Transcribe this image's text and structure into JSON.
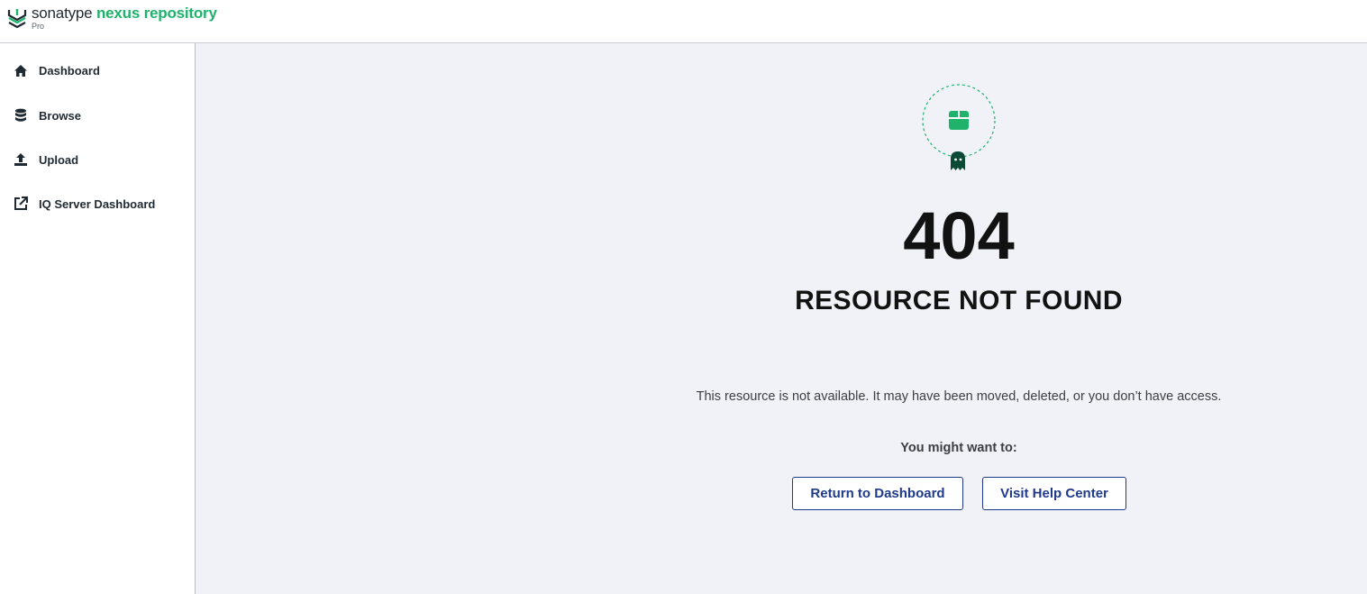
{
  "header": {
    "brand": "sonatype",
    "product": "nexus repository",
    "edition": "Pro",
    "logo_icon": "sonatype-chevron-logo"
  },
  "sidebar": {
    "items": [
      {
        "label": "Dashboard",
        "icon": "home-icon"
      },
      {
        "label": "Browse",
        "icon": "database-icon"
      },
      {
        "label": "Upload",
        "icon": "upload-icon"
      },
      {
        "label": "IQ Server Dashboard",
        "icon": "external-link-icon"
      }
    ]
  },
  "error": {
    "illustration_icon": "package-ghost-icon",
    "code": "404",
    "title": "RESOURCE NOT FOUND",
    "message": "This resource is not available. It may have been moved, deleted, or you don’t have access.",
    "suggestion_heading": "You might want to:",
    "actions": {
      "return_dashboard": "Return to Dashboard",
      "visit_help": "Visit Help Center"
    }
  },
  "colors": {
    "accent_green": "#1fb26b",
    "button_blue": "#1f3a8a",
    "main_background": "#f1f2f7",
    "ghost_dark_green": "#0d4a36"
  }
}
